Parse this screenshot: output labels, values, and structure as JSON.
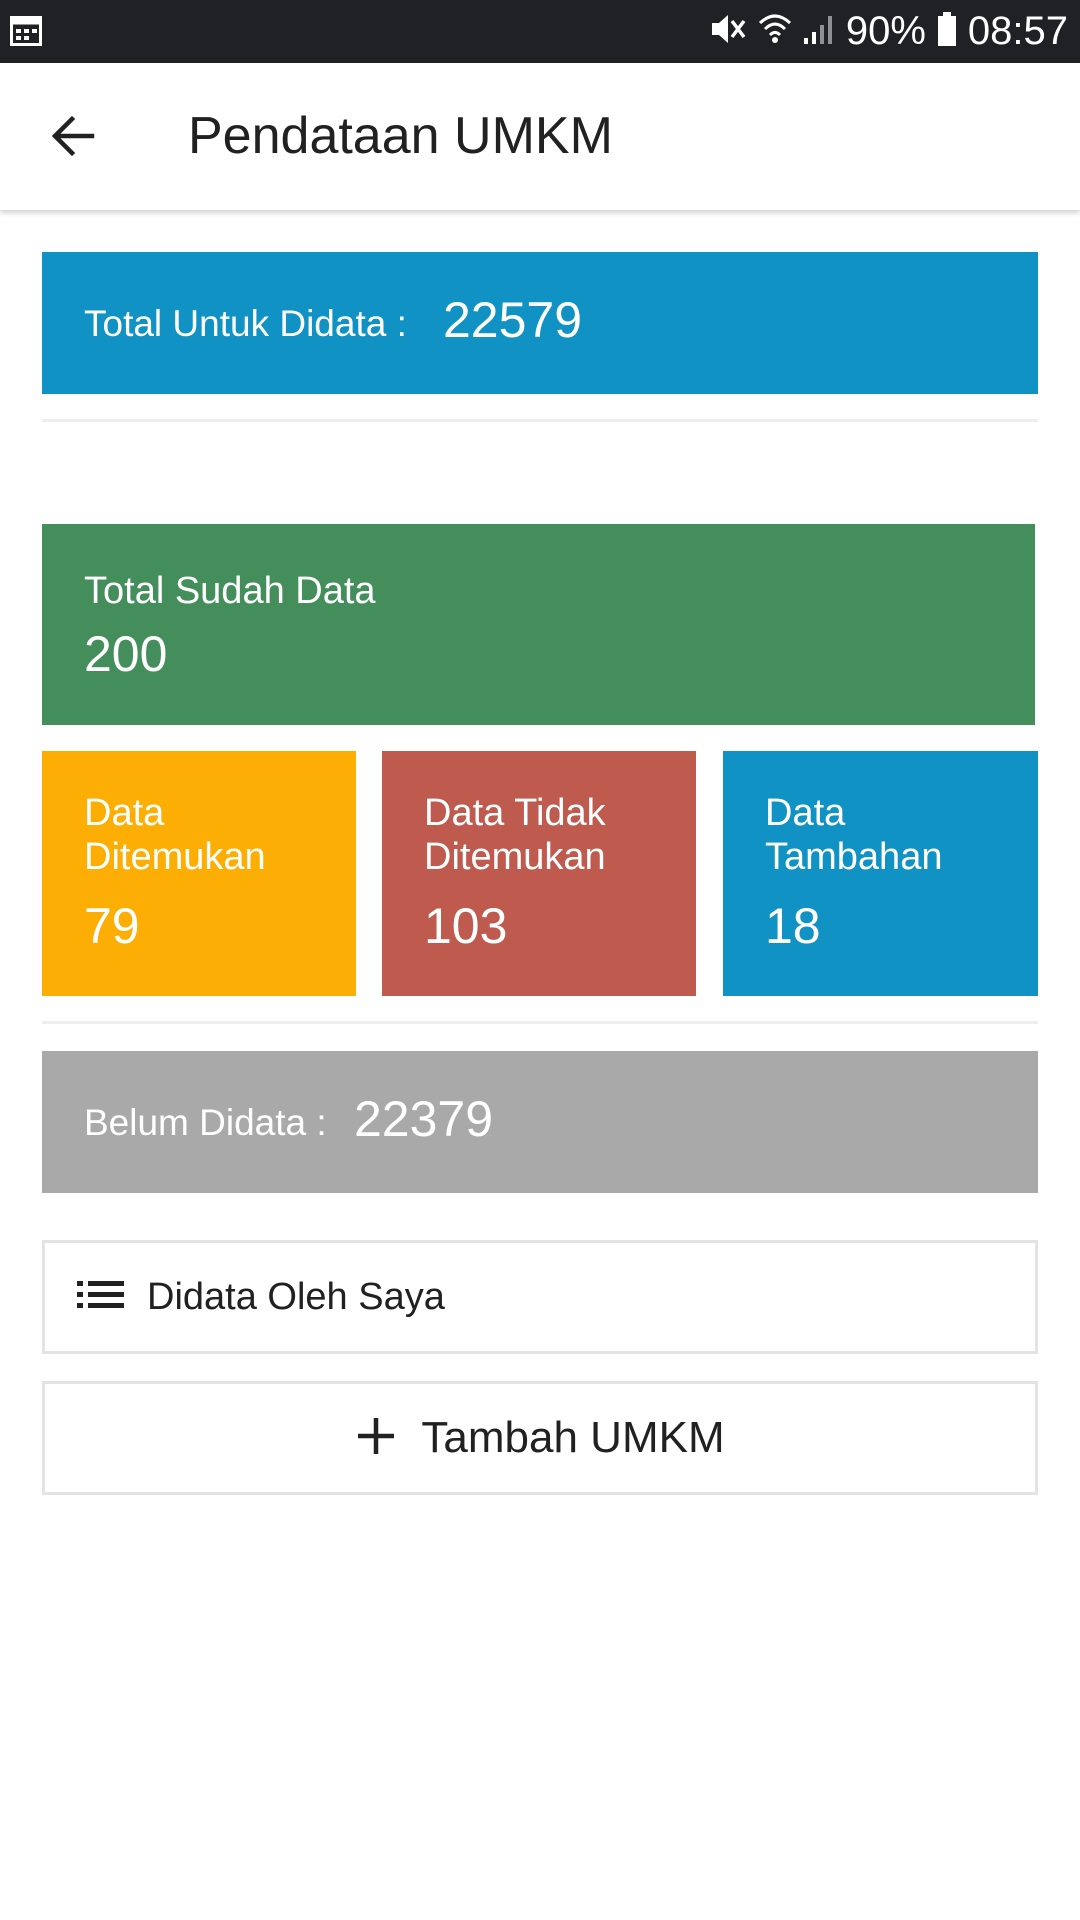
{
  "status_bar": {
    "battery": "90%",
    "time": "08:57",
    "icons": [
      "calendar-icon",
      "mute-vibrate-icon",
      "wifi-icon",
      "signal-icon",
      "battery-icon"
    ]
  },
  "app_bar": {
    "title": "Pendataan UMKM",
    "back_icon": "arrow-left-icon"
  },
  "summary": {
    "total_label": "Total Untuk Didata :",
    "total_value": "22579",
    "sudah_label": "Total Sudah Data",
    "sudah_value": "200",
    "found_label": "Data Ditemukan",
    "found_value": "79",
    "notfound_label": "Data Tidak Ditemukan",
    "notfound_value": "103",
    "extra_label": "Data Tambahan",
    "extra_value": "18",
    "belum_label": "Belum Didata :",
    "belum_value": "22379"
  },
  "actions": {
    "mine_label": "Didata Oleh Saya",
    "mine_icon": "list-icon",
    "add_label": "Tambah UMKM",
    "add_icon": "plus-icon"
  },
  "colors": {
    "status_bar": "#202124",
    "blue": "#1093c4",
    "green": "#448e5c",
    "orange": "#fdae04",
    "red": "#bf5a4f",
    "gray": "#a9a9a9"
  }
}
